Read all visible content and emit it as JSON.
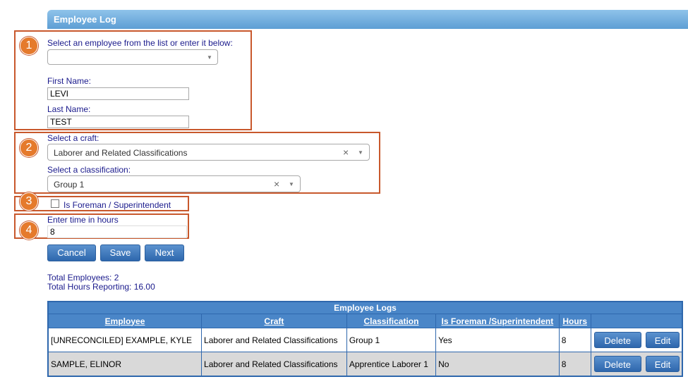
{
  "header": {
    "title": "Employee Log"
  },
  "markers": [
    "1",
    "2",
    "3",
    "4"
  ],
  "employee": {
    "select_label": "Select an employee from the list or enter it below:",
    "select_value": "",
    "first_name_label": "First Name:",
    "first_name_value": "LEVI",
    "last_name_label": "Last Name:",
    "last_name_value": "TEST"
  },
  "craft": {
    "label": "Select a craft:",
    "value": "Laborer and Related Classifications"
  },
  "classification": {
    "label": "Select a classification:",
    "value": "Group 1"
  },
  "foreman": {
    "label": "Is Foreman / Superintendent",
    "checked": false
  },
  "hours": {
    "label": "Enter time in hours",
    "value": "8"
  },
  "buttons": {
    "cancel": "Cancel",
    "save": "Save",
    "next": "Next"
  },
  "totals": {
    "employees": "Total Employees: 2",
    "hours": "Total Hours Reporting: 16.00"
  },
  "table": {
    "caption": "Employee Logs",
    "columns": [
      "Employee",
      "Craft",
      "Classification",
      "Is Foreman /Superintendent",
      "Hours",
      ""
    ],
    "rows": [
      {
        "employee": "[UNRECONCILED] EXAMPLE, KYLE",
        "craft": "Laborer and Related Classifications",
        "classification": "Group 1",
        "foreman": "Yes",
        "hours": "8",
        "delete": "Delete",
        "edit": "Edit"
      },
      {
        "employee": "SAMPLE, ELINOR",
        "craft": "Laborer and Related Classifications",
        "classification": "Apprentice Laborer 1",
        "foreman": "No",
        "hours": "8",
        "delete": "Delete",
        "edit": "Edit"
      }
    ]
  },
  "colors": {
    "header_blue": "#5d9ed4",
    "button_blue": "#2e67ad",
    "highlight_orange": "#c8582c",
    "label_navy": "#1a1a8c"
  },
  "icons": {
    "dropdown": "chevron-down-icon",
    "clear": "close-icon",
    "marker": "number-badge"
  }
}
